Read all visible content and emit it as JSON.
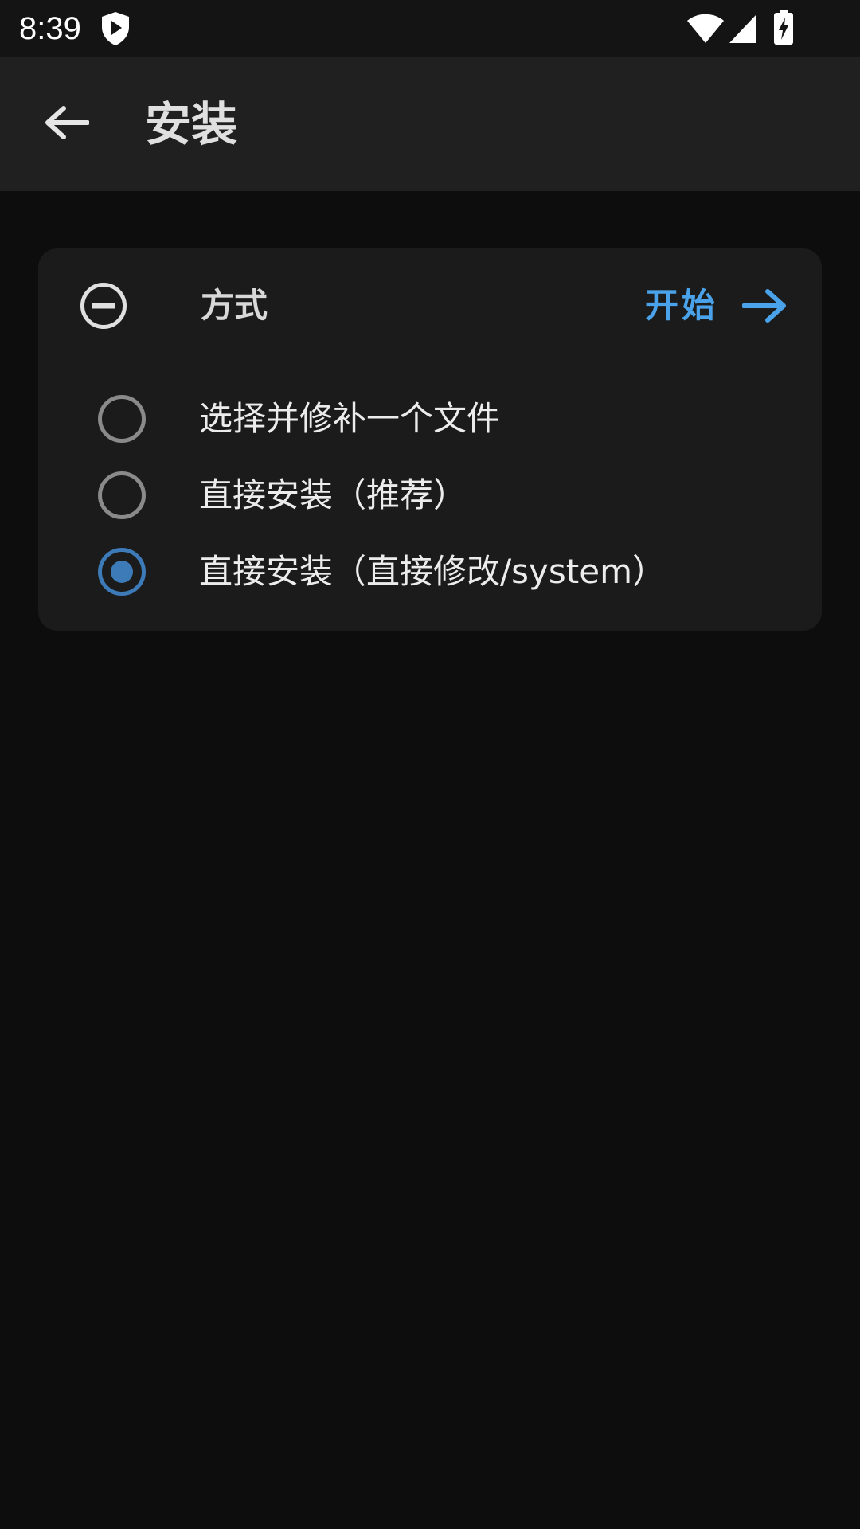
{
  "status_bar": {
    "time": "8:39",
    "icons": [
      "shield-play-icon",
      "wifi-icon",
      "cell-signal-icon",
      "battery-charging-icon"
    ]
  },
  "app_bar": {
    "back_icon": "arrow-back-icon",
    "title": "安装"
  },
  "method_card": {
    "title": "方式",
    "collapse_icon": "remove-circle-icon",
    "start_label": "开始",
    "start_icon": "arrow-forward-icon",
    "options": [
      {
        "label": "选择并修补一个文件",
        "selected": false
      },
      {
        "label": "直接安装（推荐）",
        "selected": false
      },
      {
        "label": "直接安装（直接修改/system）",
        "selected": true
      }
    ]
  },
  "colors": {
    "accent": "#4aa3ea",
    "radio_selected": "#3d7ab8",
    "background": "#0d0d0d",
    "card": "#1b1b1b",
    "app_bar": "#202020"
  }
}
